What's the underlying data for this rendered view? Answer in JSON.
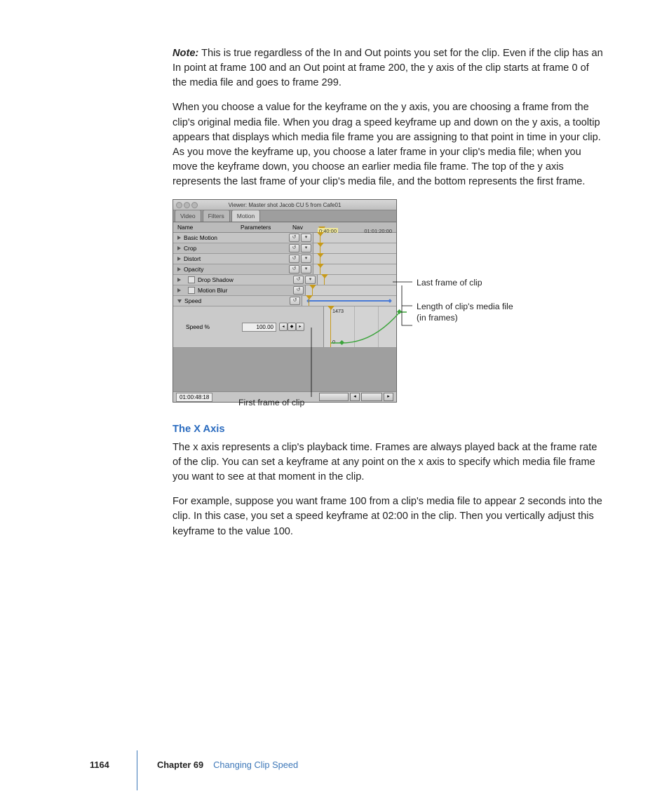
{
  "note_label": "Note:",
  "note_text": " This is true regardless of the In and Out points you set for the clip. Even if the clip has an In point at frame 100 and an Out point at frame 200, the y axis of the clip starts at frame 0 of the media file and goes to frame 299.",
  "para2": "When you choose a value for the keyframe on the y axis, you are choosing a frame from the clip's original media file. When you drag a speed keyframe up and down on the y axis, a tooltip appears that displays which media file frame you are assigning to that point in time in your clip. As you move the keyframe up, you choose a later frame in your clip's media file; when you move the keyframe down, you choose an earlier media file frame. The top of the y axis represents the last frame of your clip's media file, and the bottom represents the first frame.",
  "viewer": {
    "title": "Viewer: Master shot Jacob CU 5 from Cafe01",
    "tabs": [
      "Video",
      "Filters",
      "Motion"
    ],
    "active_tab": 2,
    "cols": {
      "name": "Name",
      "param": "Parameters",
      "nav": "Nav"
    },
    "ruler": {
      "t1": "0:40:00",
      "t2": "01:01:20:00"
    },
    "rows": [
      {
        "label": "Basic Motion",
        "disc": true
      },
      {
        "label": "Crop",
        "disc": true
      },
      {
        "label": "Distort",
        "disc": true
      },
      {
        "label": "Opacity",
        "disc": true
      },
      {
        "label": "Drop Shadow",
        "check": true
      },
      {
        "label": "Motion Blur",
        "check": true
      }
    ],
    "speed_row": "Speed",
    "speed_pct_label": "Speed %",
    "speed_value": "100.00",
    "y_top": "1473",
    "y_bottom": "0",
    "timecode": "01:00:48:18"
  },
  "callouts": {
    "last": "Last frame of clip",
    "length1": "Length of clip's media file",
    "length2": "(in frames)",
    "first": "First frame of clip"
  },
  "section_heading": "The X Axis",
  "para3": "The x axis represents a clip's playback time. Frames are always played back at the frame rate of the clip. You can set a keyframe at any point on the x axis to specify which media file frame you want to see at that moment in the clip.",
  "para4": "For example, suppose you want frame 100 from a clip's media file to appear 2 seconds into the clip. In this case, you set a speed keyframe at 02:00 in the clip. Then you vertically adjust this keyframe to the value 100.",
  "footer": {
    "page": "1164",
    "chapter": "Chapter 69",
    "title": "Changing Clip Speed"
  }
}
